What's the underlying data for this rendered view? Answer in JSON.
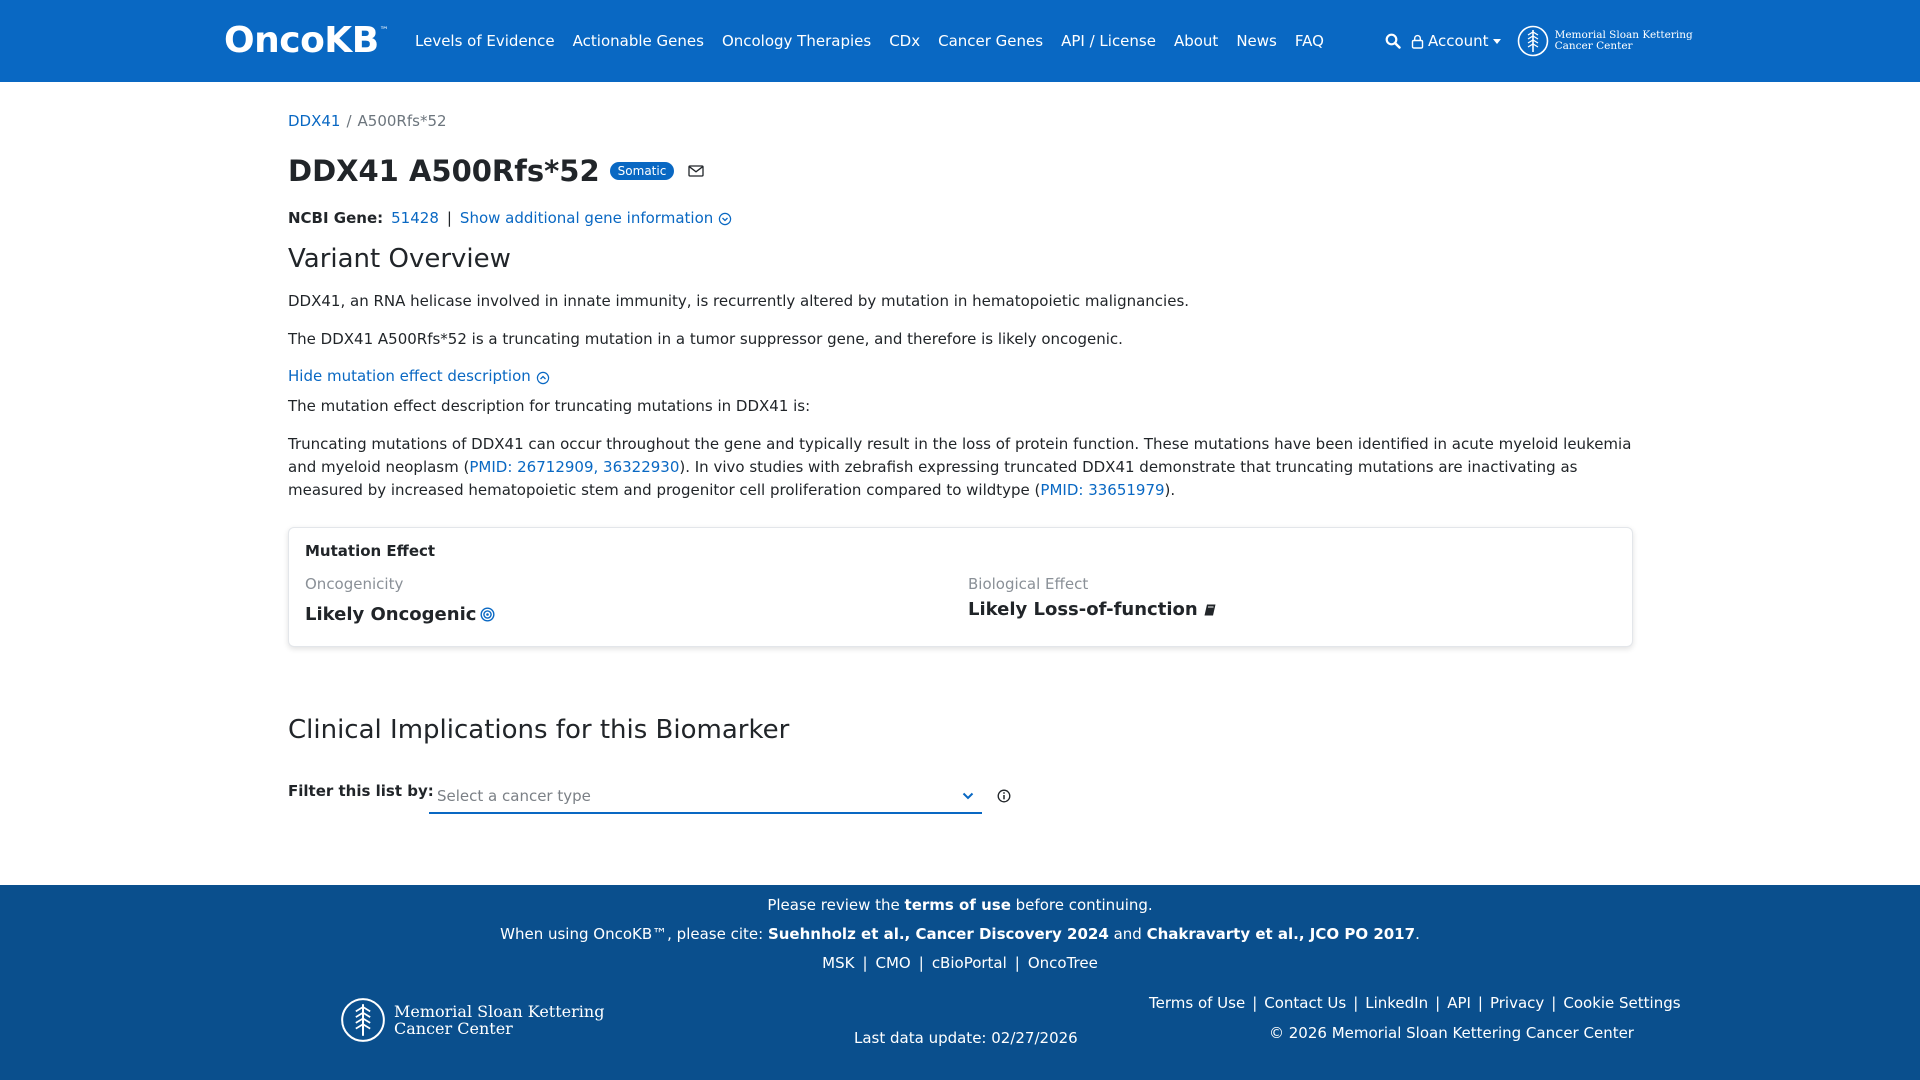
{
  "nav": {
    "logo": "OncoKB",
    "logo_tm": "™",
    "links": [
      "Levels of Evidence",
      "Actionable Genes",
      "Oncology Therapies",
      "CDx",
      "Cancer Genes",
      "API / License",
      "About",
      "News",
      "FAQ"
    ],
    "account": "Account",
    "msk_line1": "Memorial Sloan Kettering",
    "msk_line2": "Cancer Center"
  },
  "breadcrumb": {
    "gene": "DDX41",
    "separator": "/",
    "variant": "A500Rfs*52"
  },
  "header": {
    "title": "DDX41 A500Rfs*52",
    "badge": "Somatic"
  },
  "ncbi": {
    "label": "NCBI Gene:",
    "id": "51428",
    "separator": "|",
    "more_link": "Show additional gene information"
  },
  "overview": {
    "heading": "Variant Overview",
    "p1": "DDX41, an RNA helicase involved in innate immunity, is recurrently altered by mutation in hematopoietic malignancies.",
    "p2": "The DDX41 A500Rfs*52 is a truncating mutation in a tumor suppressor gene, and therefore is likely oncogenic.",
    "toggle": "Hide mutation effect description",
    "p3": "The mutation effect description for truncating mutations in DDX41 is:",
    "desc_a": "Truncating mutations of DDX41 can occur throughout the gene and typically result in the loss of protein function. These mutations have been identified in acute myeloid leukemia and myeloid neoplasm (",
    "pmid1": "PMID: 26712909, 36322930",
    "desc_b": "). In vivo studies with zebrafish expressing truncated DDX41 demonstrate that truncating mutations are inactivating as measured by increased hematopoietic stem and progenitor cell proliferation compared to wildtype (",
    "pmid2": "PMID: 33651979",
    "desc_c": ")."
  },
  "mutation_effect": {
    "title": "Mutation Effect",
    "onc_label": "Oncogenicity",
    "onc_value": "Likely Oncogenic",
    "bio_label": "Biological Effect",
    "bio_value": "Likely Loss-of-function"
  },
  "clinical": {
    "heading": "Clinical Implications for this Biomarker",
    "filter_label": "Filter this list by:",
    "select_placeholder": "Select a cancer type"
  },
  "footer": {
    "review_pre": "Please review the ",
    "review_link": "terms of use",
    "review_post": " before continuing.",
    "cite_pre": "When using OncoKB™, please cite: ",
    "cite1": "Suehnholz et al., Cancer Discovery 2024",
    "cite_and": " and ",
    "cite2": "Chakravarty et al., JCO PO 2017",
    "cite_end": ".",
    "links": [
      "MSK",
      "CMO",
      "cBioPortal",
      "OncoTree"
    ],
    "msk_line1": "Memorial Sloan Kettering",
    "msk_line2": "Cancer Center",
    "last_update": "Last data update: 02/27/2026",
    "right_links": [
      "Terms of Use",
      "Contact Us",
      "LinkedIn",
      "API",
      "Privacy",
      "Cookie Settings"
    ],
    "copyright": "© 2026 Memorial Sloan Kettering Cancer Center"
  },
  "colors": {
    "primary": "#0968c3",
    "footer_bg": "#0a4f8d"
  }
}
